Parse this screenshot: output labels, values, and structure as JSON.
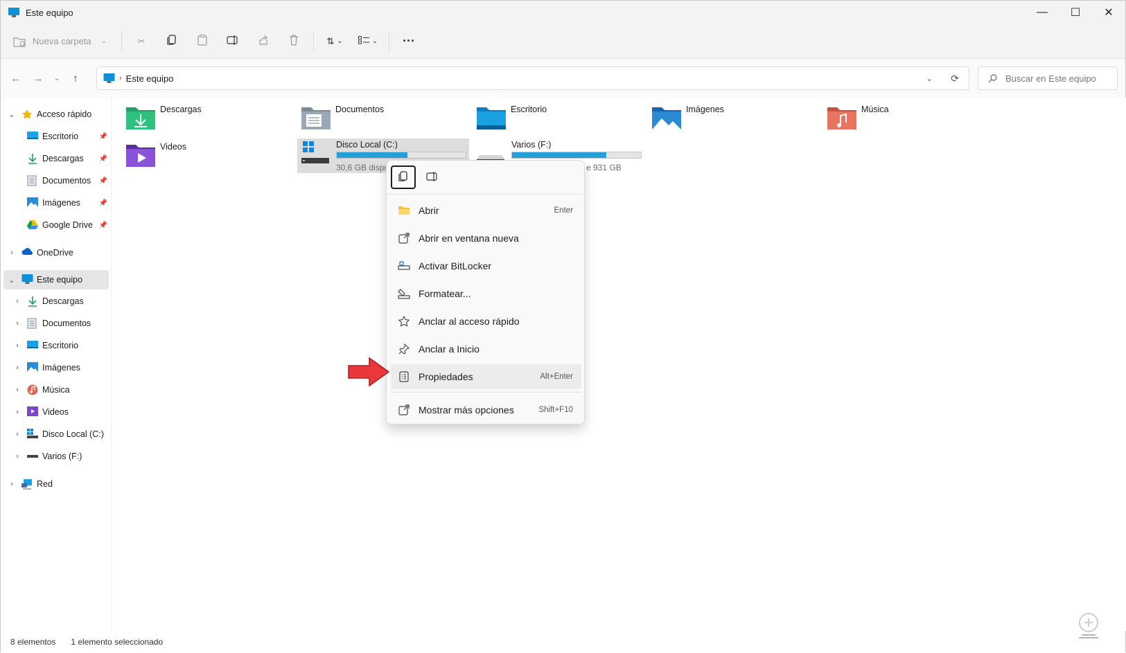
{
  "window": {
    "title": "Este equipo",
    "minimize": "—",
    "maximize": "☐",
    "close": "✕"
  },
  "toolbar": {
    "new_folder": "Nueva carpeta",
    "more": "···"
  },
  "address": {
    "path": "Este equipo",
    "search_placeholder": "Buscar en Este equipo"
  },
  "sidebar": {
    "quick_access": "Acceso rápido",
    "quick_items": [
      "Escritorio",
      "Descargas",
      "Documentos",
      "Imágenes",
      "Google Drive"
    ],
    "onedrive": "OneDrive",
    "this_pc": "Este equipo",
    "pc_items": [
      "Descargas",
      "Documentos",
      "Escritorio",
      "Imágenes",
      "Música",
      "Videos",
      "Disco Local (C:)",
      "Varios (F:)"
    ],
    "network": "Red"
  },
  "folders": [
    "Descargas",
    "Documentos",
    "Escritorio",
    "Imágenes",
    "Música",
    "Videos"
  ],
  "drives": [
    {
      "label": "Disco Local (C:)",
      "sub": "30,6 GB dispo",
      "used_fraction": 0.55
    },
    {
      "label": "Varios (F:)",
      "sub": "e 931 GB",
      "used_fraction": 0.73
    }
  ],
  "context_menu": {
    "items": [
      {
        "label": "Abrir",
        "shortcut": "Enter"
      },
      {
        "label": "Abrir en ventana nueva",
        "shortcut": ""
      },
      {
        "label": "Activar BitLocker",
        "shortcut": ""
      },
      {
        "label": "Formatear...",
        "shortcut": ""
      },
      {
        "label": "Anclar al acceso rápido",
        "shortcut": ""
      },
      {
        "label": "Anclar a Inicio",
        "shortcut": ""
      },
      {
        "label": "Propiedades",
        "shortcut": "Alt+Enter"
      },
      {
        "label": "Mostrar más opciones",
        "shortcut": "Shift+F10"
      }
    ]
  },
  "status": {
    "count": "8 elementos",
    "selected": "1 elemento seleccionado"
  },
  "colors": {
    "accent": "#26a0da",
    "arrow": "#e8383b",
    "folder": "#f5c140"
  }
}
